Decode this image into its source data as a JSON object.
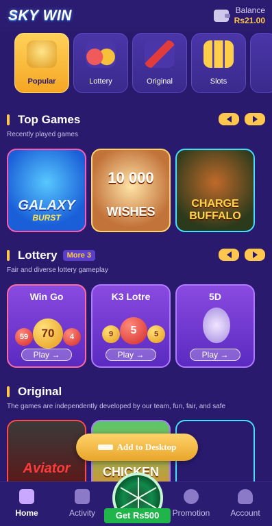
{
  "header": {
    "logo": "SKY WIN",
    "balance_label": "Balance",
    "balance_value": "Rs21.00"
  },
  "categories": [
    {
      "label": "Popular",
      "active": true
    },
    {
      "label": "Lottery",
      "active": false
    },
    {
      "label": "Original",
      "active": false
    },
    {
      "label": "Slots",
      "active": false
    }
  ],
  "top_games": {
    "title": "Top Games",
    "subtitle": "Recently played games",
    "games": [
      {
        "title_line1": "GALAXY",
        "title_line2": "BURST"
      },
      {
        "title_line1": "10 000",
        "title_line2": "WISHES"
      },
      {
        "title_line1": "CHARGE",
        "title_line2": "BUFFALO"
      }
    ]
  },
  "lottery": {
    "title": "Lottery",
    "badge": "More 3",
    "subtitle": "Fair and diverse lottery gameplay",
    "games": [
      {
        "name": "Win Go",
        "play": "Play →",
        "balls": [
          "59",
          "70",
          "4"
        ]
      },
      {
        "name": "K3 Lotre",
        "play": "Play →",
        "balls": [
          "9",
          "5",
          "5"
        ]
      },
      {
        "name": "5D",
        "play": "Play →",
        "balls": []
      }
    ]
  },
  "original": {
    "title": "Original",
    "subtitle": "The games are independently developed by our team, fun, fair, and safe",
    "games": [
      {
        "name": "Aviator"
      },
      {
        "name": "CHICKEN"
      },
      {
        "name": ""
      }
    ]
  },
  "add_desktop": "Add to Desktop",
  "nav": [
    {
      "label": "Home",
      "active": true
    },
    {
      "label": "Activity",
      "active": false
    },
    {
      "label": "Promotion",
      "active": false
    },
    {
      "label": "Account",
      "active": false
    }
  ],
  "promo": {
    "label": "Get Rs500"
  },
  "colors": {
    "accent": "#ffc74d",
    "background": "#2a1a6e"
  }
}
